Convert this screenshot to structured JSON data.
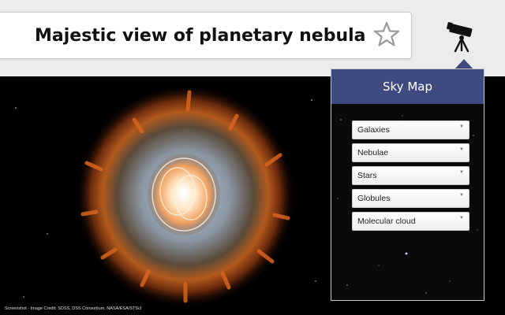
{
  "header": {
    "title": "Majestic view of planetary nebula",
    "favorite_icon": "star-outline-icon",
    "skymap_icon": "telescope-icon"
  },
  "image": {
    "subject": "planetary nebula",
    "credit": "Screenshot - Image Credit: SDSS, DSS Consortium, NASA/ESA/STScI"
  },
  "sky_map": {
    "title": "Sky Map",
    "dropdowns": [
      {
        "label": "Galaxies"
      },
      {
        "label": "Nebulae"
      },
      {
        "label": "Stars"
      },
      {
        "label": "Globules"
      },
      {
        "label": "Molecular cloud"
      }
    ]
  },
  "colors": {
    "panel_header": "#3e4a80",
    "topbar": "#ececec"
  }
}
